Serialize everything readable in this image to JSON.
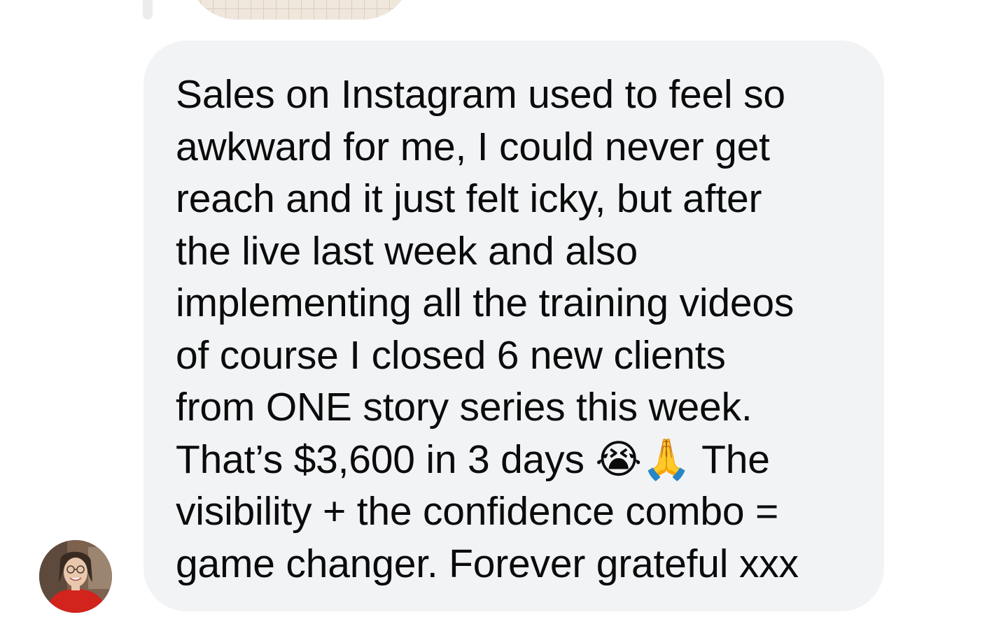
{
  "chat": {
    "message": {
      "sender": "contact",
      "text": "Sales on Instagram used to feel so\nawkward for me, I could never get\nreach and it just felt icky, but after\nthe live last week and also\nimplementing all the training videos\nof course I closed 6 new clients\nfrom ONE story series this week.\nThat’s $3,600 in 3 days 😭🙏 The\nvisibility + the confidence combo =\ngame changer. Forever grateful xxx"
    },
    "avatar": {
      "icon": "contact-avatar-photo"
    },
    "previous_attachment": {
      "icon": "grid-pattern-image-thumbnail"
    }
  },
  "colors": {
    "background": "#ffffff",
    "bubble": "#f2f3f5",
    "text": "#0b0b0b",
    "reply_bar": "#ececee"
  }
}
